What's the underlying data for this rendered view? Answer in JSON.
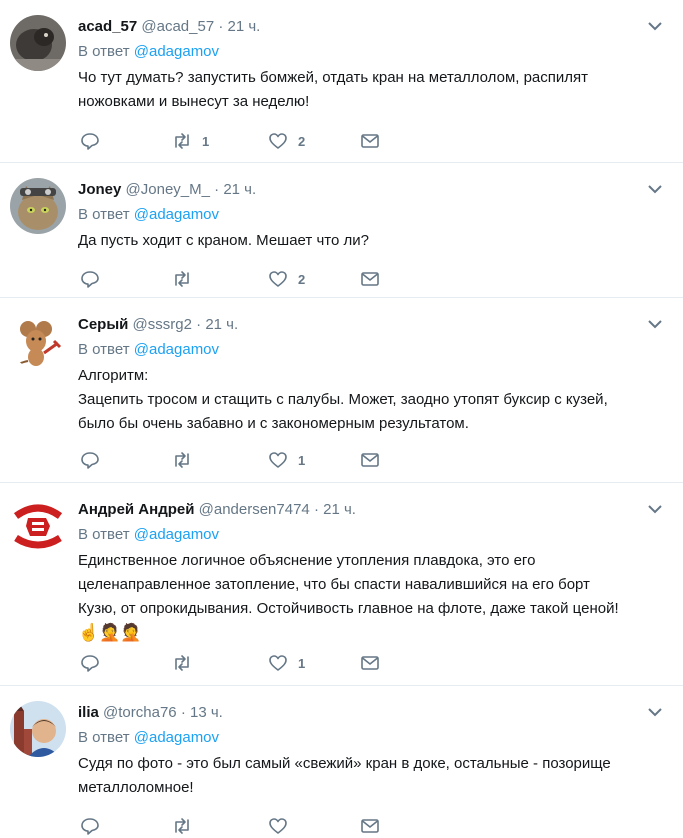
{
  "colors": {
    "accent": "#1da1f2",
    "muted": "#657786",
    "text": "#14171a",
    "divider": "#e6ecf0"
  },
  "tweets": [
    {
      "name": "acad_57",
      "handle": "@acad_57",
      "sep": "·",
      "time": "21 ч.",
      "reply_prefix": "В ответ",
      "reply_to": "@adagamov",
      "text": "Чо тут думать? запустить бомжей, отдать кран на металлолом, распилят\nножовками и вынесут за неделю!",
      "emojis": "",
      "retweets": "1",
      "likes": "2",
      "replies": "",
      "avatar": "dark-animal-photo"
    },
    {
      "name": "Joney",
      "handle": "@Joney_M_",
      "sep": "·",
      "time": "21 ч.",
      "reply_prefix": "В ответ",
      "reply_to": "@adagamov",
      "text": "Да пусть ходит с краном. Мешает что ли?",
      "emojis": "",
      "retweets": "",
      "likes": "2",
      "replies": "",
      "avatar": "cat-photo"
    },
    {
      "name": "Серый",
      "handle": "@sssrg2",
      "sep": "·",
      "time": "21 ч.",
      "reply_prefix": "В ответ",
      "reply_to": "@adagamov",
      "text": "Алгоритм:\nЗацепить тросом и стащить с палубы. Может, заодно утопят буксир с кузей,\nбыло бы очень забавно и с закономерным результатом.",
      "emojis": "",
      "retweets": "",
      "likes": "1",
      "replies": "",
      "avatar": "cartoon-mouse"
    },
    {
      "name": "Андрей Андрей",
      "handle": "@andersen7474",
      "sep": "·",
      "time": "21 ч.",
      "reply_prefix": "В ответ",
      "reply_to": "@adagamov",
      "text": "Единственное логичное объяснение утопления плавдока, это его\nцеленаправленное затопление, что бы спасти навалившийся на его борт\nКузю, от опрокидывания. Остойчивость главное на флоте, даже такой ценой!",
      "emojis": "☝🤦🤦",
      "retweets": "",
      "likes": "1",
      "replies": "",
      "avatar": "revolution-logo"
    },
    {
      "name": "ilia",
      "handle": "@torcha76",
      "sep": "·",
      "time": "13 ч.",
      "reply_prefix": "В ответ",
      "reply_to": "@adagamov",
      "text": "Судя по фото - это был самый «свежий» кран в доке, остальные - позорище\nметаллоломное!",
      "emojis": "",
      "retweets": "",
      "likes": "",
      "replies": "",
      "avatar": "person-photo"
    }
  ]
}
